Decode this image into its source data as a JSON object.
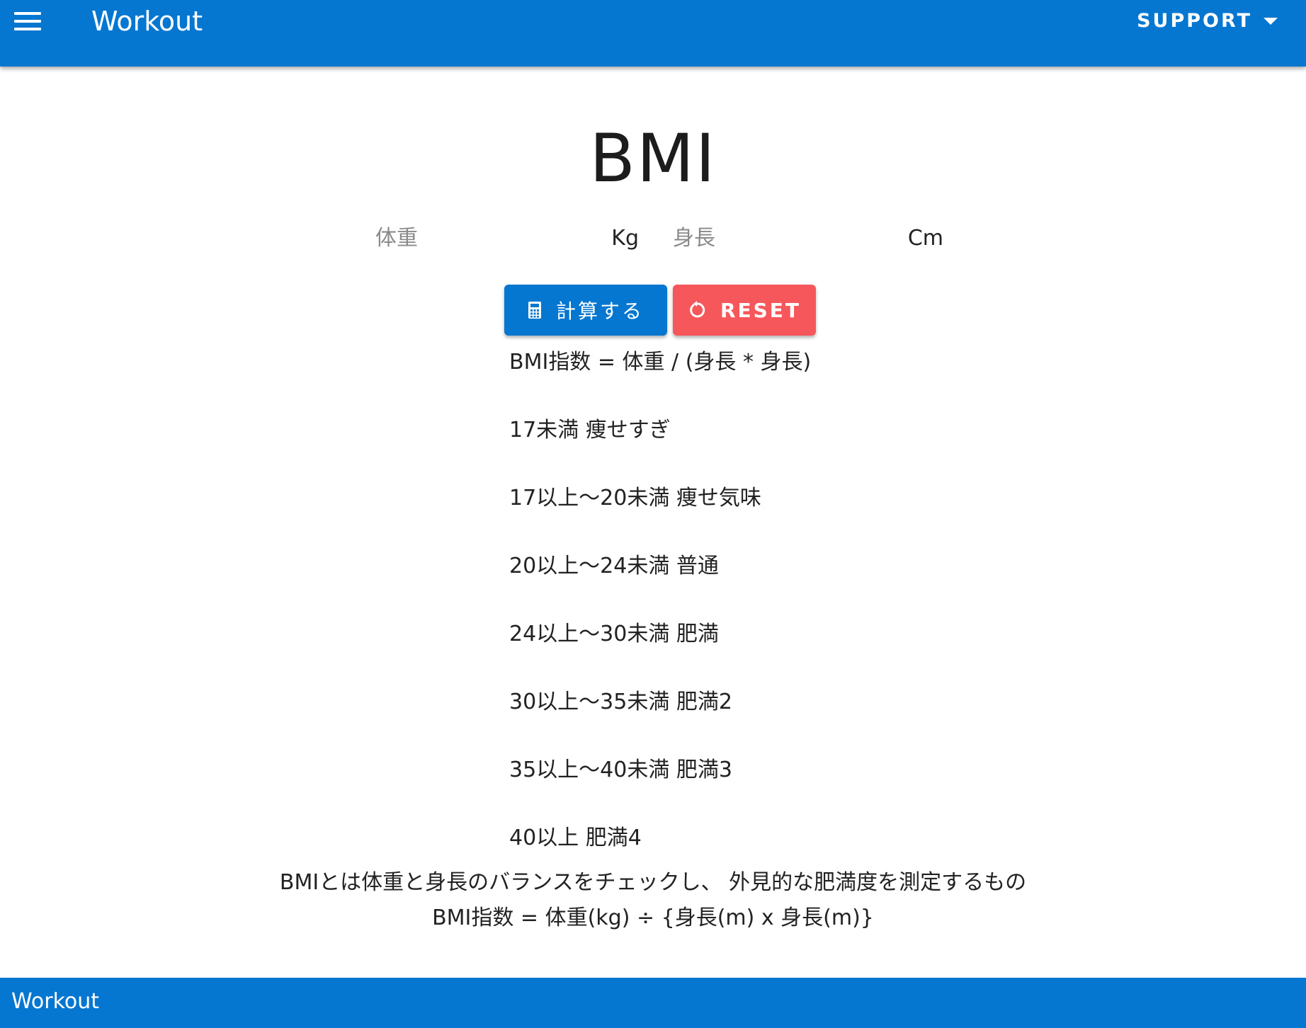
{
  "app_bar": {
    "title": "Workout",
    "menu_icon": "hamburger-menu-icon",
    "support_label": "SUPPORT",
    "support_caret_icon": "caret-down-icon",
    "color": "#0677d1"
  },
  "main": {
    "title": "BMI",
    "weight_field": {
      "placeholder": "体重",
      "value": "",
      "unit": "Kg"
    },
    "height_field": {
      "placeholder": "身長",
      "value": "",
      "unit": "Cm"
    },
    "calculate_button": {
      "label": "計算する",
      "icon": "calculator-icon",
      "color": "#0677d1"
    },
    "reset_button": {
      "label": "RESET",
      "icon": "reset-icon",
      "color": "#f6575a"
    },
    "formula": "BMI指数 = 体重 / (身長 * 身長)",
    "ranges": [
      "17未満 痩せすぎ",
      "17以上～20未満 痩せ気味",
      "20以上～24未満 普通",
      "24以上～30未満 肥満",
      "30以上～35未満 肥満2",
      "35以上～40未満 肥満3",
      "40以上 肥満4"
    ],
    "description_line1": "BMIとは体重と身長のバランスをチェックし、 外見的な肥満度を測定するもの",
    "description_line2": "BMI指数 = 体重(kg) ÷ {身長(m) x 身長(m)}"
  },
  "footer": {
    "title": "Workout"
  }
}
